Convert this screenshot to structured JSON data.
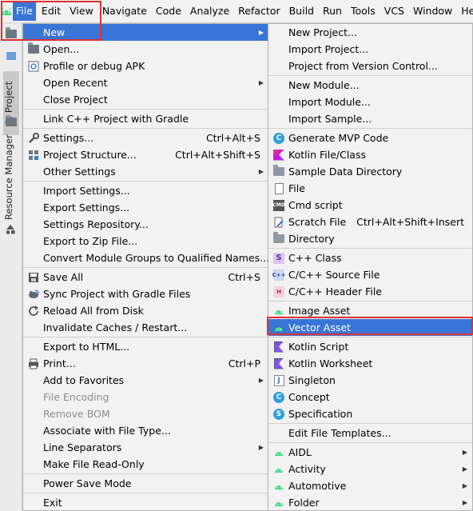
{
  "menubar": {
    "items": [
      "File",
      "Edit",
      "View",
      "Navigate",
      "Code",
      "Analyze",
      "Refactor",
      "Build",
      "Run",
      "Tools",
      "VCS",
      "Window",
      "He"
    ]
  },
  "left_strip": {
    "project_tab": "1: Project",
    "resource_tab": "Resource Manager"
  },
  "file_menu": {
    "items": [
      {
        "label": "New",
        "submenu": true,
        "highlighted": true
      },
      {
        "label": "Open...",
        "icon": "folder-open-icon"
      },
      {
        "label": "Profile or debug APK",
        "icon": "apk-icon"
      },
      {
        "label": "Open Recent",
        "submenu": true
      },
      {
        "label": "Close Project"
      },
      {
        "label": "Link C++ Project with Gradle"
      },
      {
        "label": "Settings...",
        "shortcut": "Ctrl+Alt+S",
        "icon": "wrench-icon"
      },
      {
        "label": "Project Structure...",
        "shortcut": "Ctrl+Alt+Shift+S",
        "icon": "project-structure-icon"
      },
      {
        "label": "Other Settings",
        "submenu": true
      },
      {
        "label": "Import Settings..."
      },
      {
        "label": "Export Settings..."
      },
      {
        "label": "Settings Repository..."
      },
      {
        "label": "Export to Zip File..."
      },
      {
        "label": "Convert Module Groups to Qualified Names..."
      },
      {
        "label": "Save All",
        "shortcut": "Ctrl+S",
        "icon": "save-icon"
      },
      {
        "label": "Sync Project with Gradle Files",
        "icon": "gradle-sync-icon"
      },
      {
        "label": "Reload All from Disk",
        "icon": "reload-icon"
      },
      {
        "label": "Invalidate Caches / Restart..."
      },
      {
        "label": "Export to HTML..."
      },
      {
        "label": "Print...",
        "shortcut": "Ctrl+P",
        "icon": "printer-icon"
      },
      {
        "label": "Add to Favorites",
        "submenu": true
      },
      {
        "label": "File Encoding",
        "disabled": true
      },
      {
        "label": "Remove BOM",
        "disabled": true
      },
      {
        "label": "Associate with File Type..."
      },
      {
        "label": "Line Separators",
        "submenu": true
      },
      {
        "label": "Make File Read-Only"
      },
      {
        "label": "Power Save Mode"
      },
      {
        "label": "Exit"
      }
    ]
  },
  "new_menu": {
    "items": [
      {
        "label": "New Project..."
      },
      {
        "label": "Import Project..."
      },
      {
        "label": "Project from Version Control..."
      },
      {
        "label": "New Module..."
      },
      {
        "label": "Import Module..."
      },
      {
        "label": "Import Sample..."
      },
      {
        "label": "Generate MVP Code",
        "icon": "class-c-icon"
      },
      {
        "label": "Kotlin File/Class",
        "icon": "kotlin-icon"
      },
      {
        "label": "Sample Data Directory",
        "icon": "folder-icon"
      },
      {
        "label": "File",
        "icon": "file-icon"
      },
      {
        "label": "Cmd script",
        "icon": "cmd-icon"
      },
      {
        "label": "Scratch File",
        "shortcut": "Ctrl+Alt+Shift+Insert",
        "icon": "scratch-icon"
      },
      {
        "label": "Directory",
        "icon": "folder-icon"
      },
      {
        "label": "C++ Class",
        "icon": "cpp-class-icon"
      },
      {
        "label": "C/C++ Source File",
        "icon": "cpp-source-icon"
      },
      {
        "label": "C/C++ Header File",
        "icon": "cpp-header-icon"
      },
      {
        "label": "Image Asset",
        "icon": "android-icon"
      },
      {
        "label": "Vector Asset",
        "icon": "android-icon",
        "highlighted": true
      },
      {
        "label": "Kotlin Script",
        "icon": "kotlin-script-icon"
      },
      {
        "label": "Kotlin Worksheet",
        "icon": "kotlin-worksheet-icon"
      },
      {
        "label": "Singleton",
        "icon": "singleton-icon"
      },
      {
        "label": "Concept",
        "icon": "concept-icon"
      },
      {
        "label": "Specification",
        "icon": "specification-icon"
      },
      {
        "label": "Edit File Templates..."
      },
      {
        "label": "AIDL",
        "icon": "android-icon",
        "submenu": true
      },
      {
        "label": "Activity",
        "icon": "android-icon",
        "submenu": true
      },
      {
        "label": "Automotive",
        "icon": "android-icon",
        "submenu": true
      },
      {
        "label": "Folder",
        "icon": "android-icon",
        "submenu": true
      }
    ]
  },
  "colors": {
    "highlight": "#3875d7",
    "annotation_red": "#e03030",
    "android_green": "#3ddc84"
  }
}
